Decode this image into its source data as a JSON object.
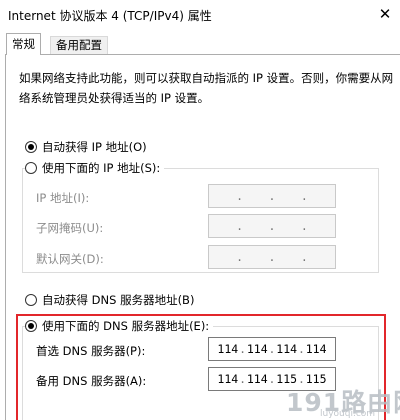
{
  "window": {
    "title": "Internet 协议版本 4 (TCP/IPv4) 属性"
  },
  "tabs": [
    {
      "label": "常规",
      "active": true
    },
    {
      "label": "备用配置",
      "active": false
    }
  ],
  "description": "如果网络支持此功能，则可以获取自动指派的 IP 设置。否则，你需要从网络系统管理员处获得适当的 IP 设置。",
  "ip_section": {
    "auto_label": "自动获得 IP 地址(O)",
    "manual_label": "使用下面的 IP 地址(S):",
    "selected": "auto",
    "fields": [
      {
        "label": "IP 地址(I):",
        "octets": [
          "",
          "",
          "",
          ""
        ]
      },
      {
        "label": "子网掩码(U):",
        "octets": [
          "",
          "",
          "",
          ""
        ]
      },
      {
        "label": "默认网关(D):",
        "octets": [
          "",
          "",
          "",
          ""
        ]
      }
    ]
  },
  "dns_section": {
    "auto_label": "自动获得 DNS 服务器地址(B)",
    "manual_label": "使用下面的 DNS 服务器地址(E):",
    "selected": "manual",
    "preferred": {
      "label": "首选 DNS 服务器(P):",
      "octets": [
        "114",
        "114",
        "114",
        "114"
      ]
    },
    "alternate": {
      "label": "备用 DNS 服务器(A):",
      "octets": [
        "114",
        "114",
        "115",
        "115"
      ]
    }
  },
  "highlight_color": "#e2262b",
  "watermark": {
    "main": "191路由网",
    "sub": "luyouqi.com"
  },
  "icons": {
    "close": "close-icon"
  }
}
